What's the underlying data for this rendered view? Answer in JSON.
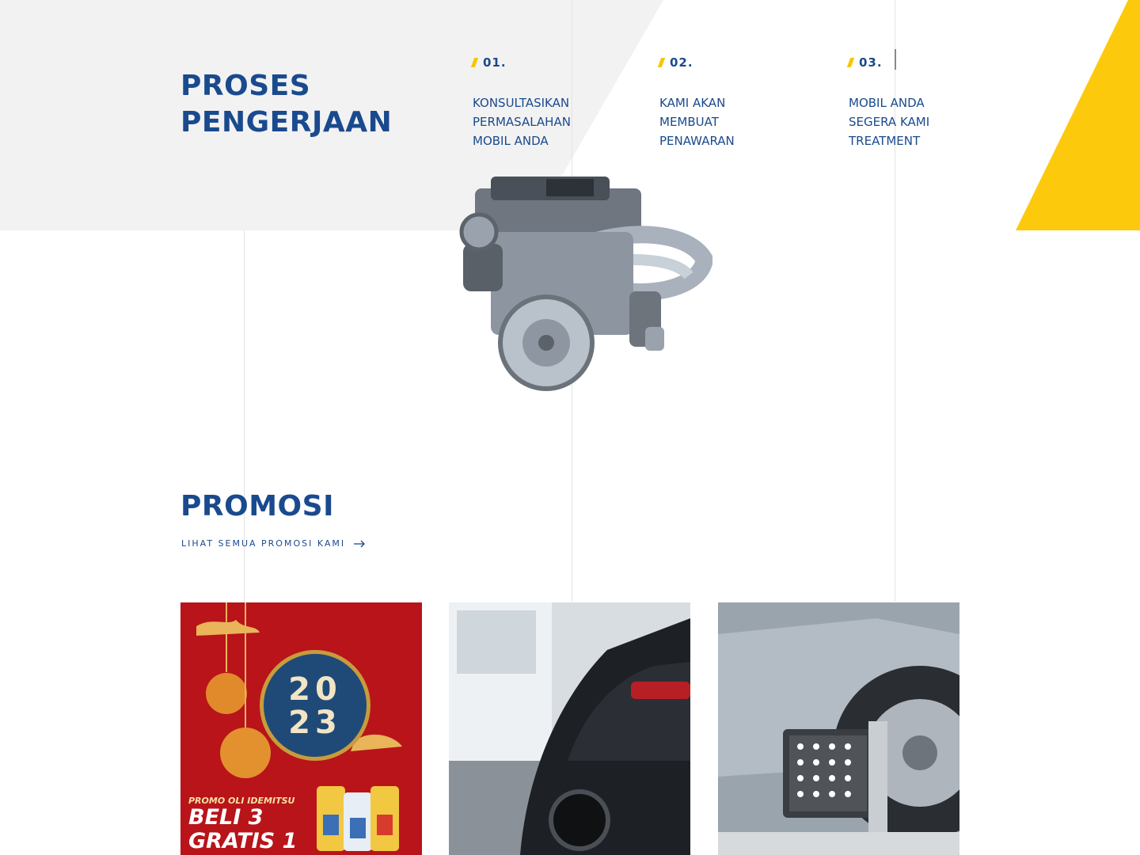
{
  "process": {
    "title_line1": "PROSES",
    "title_line2": "PENGERJAAN",
    "steps": [
      {
        "num": "01.",
        "lines": [
          "KONSULTASIKAN",
          "PERMASALAHAN",
          "MOBIL ANDA"
        ]
      },
      {
        "num": "02.",
        "lines": [
          "KAMI AKAN",
          "MEMBUAT",
          "PENAWARAN"
        ]
      },
      {
        "num": "03.",
        "lines": [
          "MOBIL ANDA",
          "SEGERA KAMI",
          "TREATMENT"
        ]
      }
    ]
  },
  "promo": {
    "title": "PROMOSI",
    "link_label": "LIHAT SEMUA PROMOSI KAMI",
    "cards": [
      {
        "image": "promo-idemitsu-2023",
        "year_top": "20",
        "year_bottom": "23",
        "caption_small": "PROMO OLI IDEMITSU",
        "caption_line1": "BELI 3",
        "caption_line2": "GRATIS 1"
      },
      {
        "image": "car-wash-photo"
      },
      {
        "image": "wheel-alignment-photo"
      }
    ]
  },
  "colors": {
    "brand_blue": "#1a4a8e",
    "accent_yellow": "#f7c600",
    "band_gray": "#f2f2f2"
  },
  "icons": {
    "link_arrow": "arrow-right-icon",
    "step_marker": "slash-icon"
  }
}
